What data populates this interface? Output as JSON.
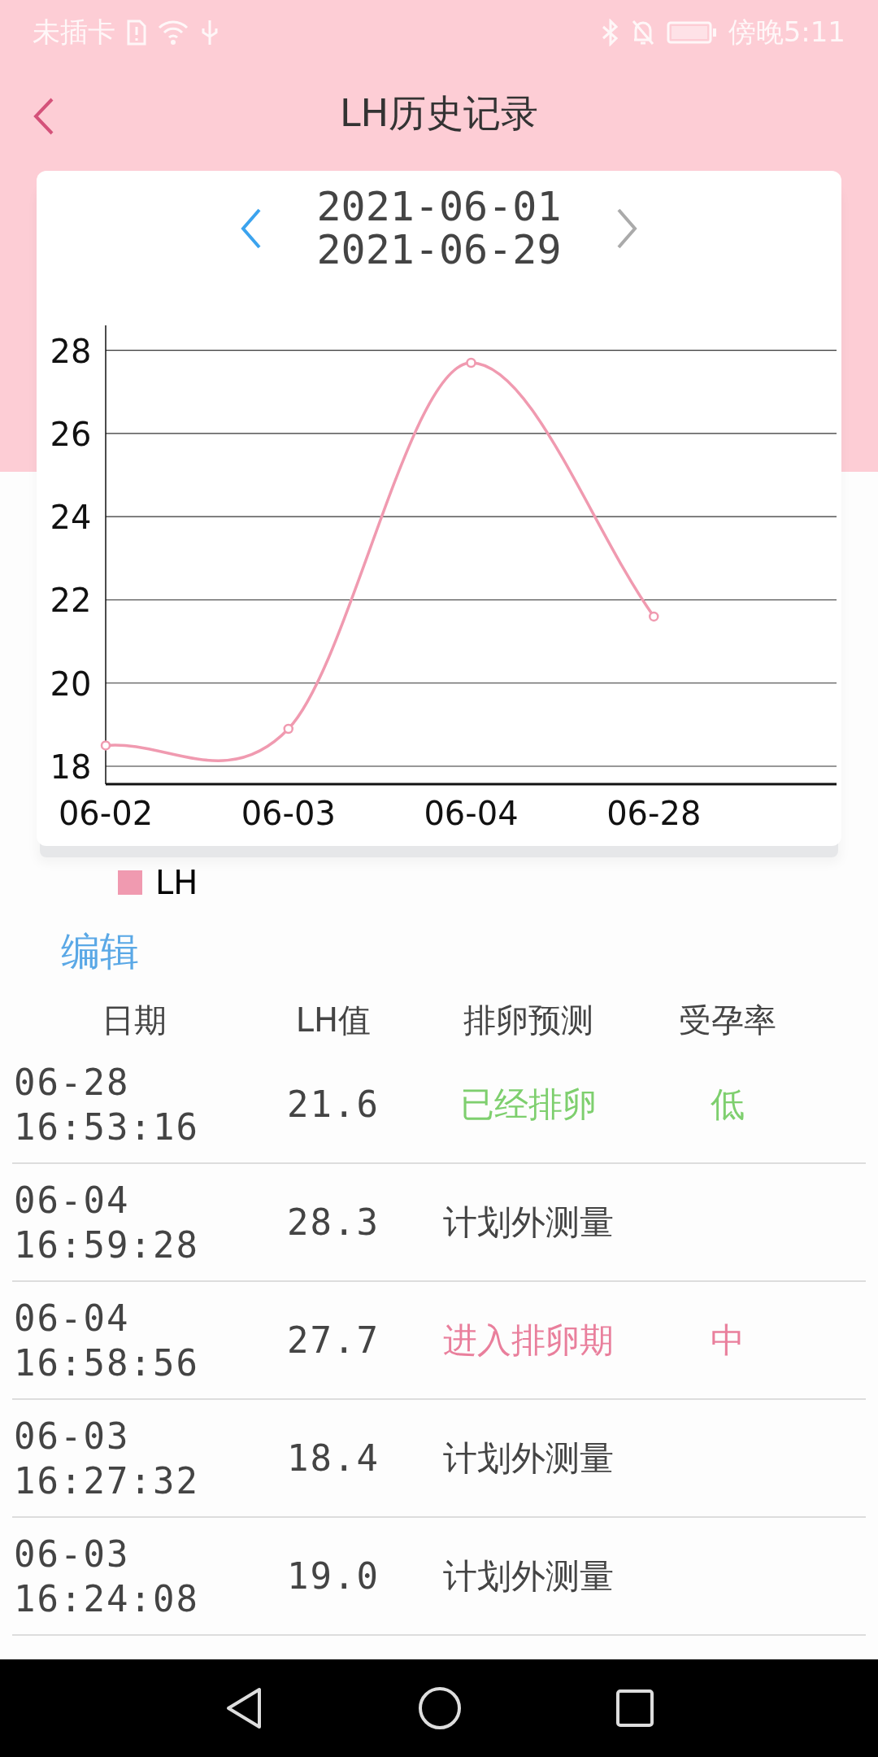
{
  "status_bar": {
    "carrier": "未插卡",
    "time": "傍晚5:11"
  },
  "header": {
    "title": "LH历史记录"
  },
  "date_range": {
    "start": "2021-06-01",
    "end": "2021-06-29"
  },
  "chart": {
    "chart_data": {
      "type": "line",
      "categories": [
        "06-02",
        "06-03",
        "06-04",
        "06-28"
      ],
      "ylim": [
        17.57,
        28.6
      ],
      "yticks": [
        18,
        20,
        22,
        24,
        26,
        28
      ],
      "grid": true,
      "series": [
        {
          "name": "LH",
          "color": "#f09ab0",
          "marker": true,
          "values": [
            18.5,
            18.9,
            27.7,
            21.6
          ]
        }
      ]
    }
  },
  "edit_link": "编辑",
  "table": {
    "columns": [
      "日期",
      "LH值",
      "排卵预测",
      "受孕率"
    ],
    "rows": [
      {
        "date": "06-28",
        "time": "16:53:16",
        "value": "21.6",
        "prediction": "已经排卵",
        "rate": "低",
        "color": "#7ecf6e"
      },
      {
        "date": "06-04",
        "time": "16:59:28",
        "value": "28.3",
        "prediction": "计划外测量",
        "color": "#444444"
      },
      {
        "date": "06-04",
        "time": "16:58:56",
        "value": "27.7",
        "prediction": "进入排卵期",
        "rate": "中",
        "color": "#e97f9c"
      },
      {
        "date": "06-03",
        "time": "16:27:32",
        "value": "18.4",
        "prediction": "计划外测量",
        "color": "#444444"
      },
      {
        "date": "06-03",
        "time": "16:24:08",
        "value": "19.0",
        "prediction": "计划外测量",
        "color": "#444444"
      }
    ]
  }
}
